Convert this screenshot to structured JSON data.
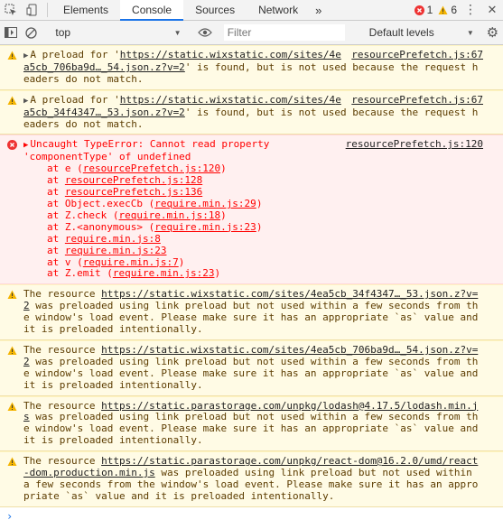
{
  "tabs": {
    "elements": "Elements",
    "console": "Console",
    "sources": "Sources",
    "network": "Network"
  },
  "badges": {
    "errors": "1",
    "warnings": "6"
  },
  "toolbar": {
    "context": "top",
    "filter_placeholder": "Filter",
    "levels": "Default levels"
  },
  "messages": {
    "m1": {
      "prefix": "A preload for '",
      "url": "https://static.wixstatic.com/sites/4",
      "url2": "ea5cb_706ba9d…_54.json.z?v=2",
      "rest": "' is found, but is not used because the request headers do not match.",
      "source": "resourcePrefetch.js:67"
    },
    "m2": {
      "prefix": "A preload for '",
      "url": "https://static.wixstatic.com/sites/4",
      "url2": "ea5cb_34f4347…_53.json.z?v=2",
      "rest": "' is found, but is not used because the request headers do not match.",
      "source": "resourcePrefetch.js:67"
    },
    "error": {
      "head": "Uncaught TypeError: Cannot read property",
      "head2": "'componentType' of undefined",
      "source": "resourcePrefetch.js:120",
      "s1_pre": "at e (",
      "s1_link": "resourcePrefetch.js:120",
      "s1_post": ")",
      "s2_pre": "at ",
      "s2_link": "resourcePrefetch.js:128",
      "s3_pre": "at ",
      "s3_link": "resourcePrefetch.js:136",
      "s4_pre": "at Object.execCb (",
      "s4_link": "require.min.js:29",
      "s4_post": ")",
      "s5_pre": "at Z.check (",
      "s5_link": "require.min.js:18",
      "s5_post": ")",
      "s6_pre": "at Z.<anonymous> (",
      "s6_link": "require.min.js:23",
      "s6_post": ")",
      "s7_pre": "at ",
      "s7_link": "require.min.js:8",
      "s8_pre": "at ",
      "s8_link": "require.min.js:23",
      "s9_pre": "at v (",
      "s9_link": "require.min.js:7",
      "s9_post": ")",
      "s10_pre": "at Z.emit (",
      "s10_link": "require.min.js:23",
      "s10_post": ")"
    },
    "m3": {
      "prefix": "The resource ",
      "url": "https://static.wixstatic.com/sites/4ea5cb_34f4347…_53.json.z?v=2",
      "rest": " was preloaded using link preload but not used within a few seconds from the window's load event. Please make sure it has an appropriate `as` value and it is preloaded intentionally."
    },
    "m4": {
      "prefix": "The resource ",
      "url": "https://static.wixstatic.com/sites/4ea5cb_706ba9d…_54.json.z?v=2",
      "rest": " was preloaded using link preload but not used within a few seconds from the window's load event. Please make sure it has an appropriate `as` value and it is preloaded intentionally."
    },
    "m5": {
      "prefix": "The resource ",
      "url": "https://static.parastorage.com/unpkg/lodash@4.17.5/lodash.min.js",
      "rest": " was preloaded using link preload but not used within a few seconds from the window's load event. Please make sure it has an appropriate `as` value and it is preloaded intentionally."
    },
    "m6": {
      "prefix": "The resource ",
      "url": "https://static.parastorage.com/unpkg/react-dom@16.2.0/umd/react-dom.production.min.js",
      "rest": " was preloaded using link preload but not used within a few seconds from the window's load event. Please make sure it has an appropriate `as` value and it is preloaded intentionally."
    }
  },
  "prompt_symbol": "›",
  "colors": {
    "accent": "#1a73e8",
    "error": "#ff0000",
    "warning_bg": "#fffbe5",
    "error_bg": "#fff0f0"
  },
  "icons": [
    "element-picker-icon",
    "device-toolbar-icon",
    "menu-dots-icon",
    "drawer-toggle-icon",
    "clear-console-icon",
    "eye-icon",
    "settings-gear-icon",
    "warning-icon",
    "error-icon"
  ]
}
